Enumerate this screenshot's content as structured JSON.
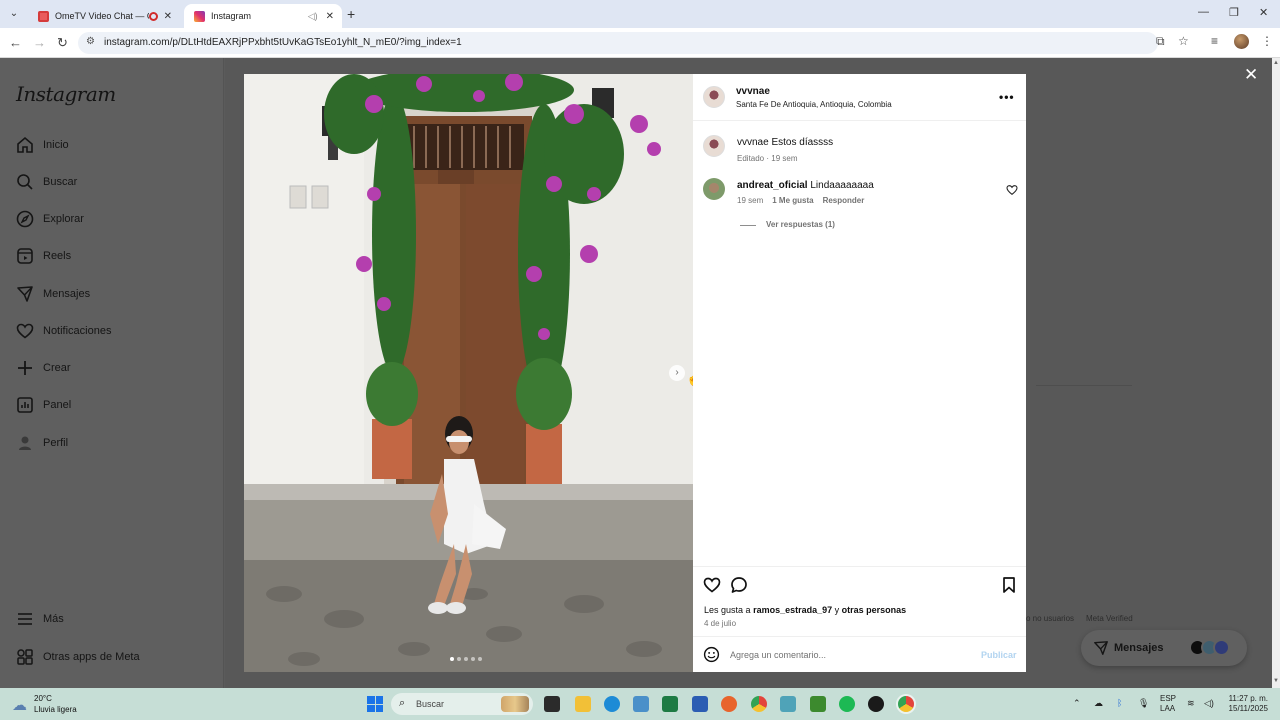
{
  "browser": {
    "tabs": [
      {
        "title": "OmeTV Video Chat — Ome",
        "active": false
      },
      {
        "title": "Instagram",
        "active": true
      }
    ],
    "url": "instagram.com/p/DLtHtdEAXRjPPxbht5tUvKaGTsEo1yhlt_N_mE0/?img_index=1"
  },
  "sidebar": {
    "logo": "Instagram",
    "items": [
      {
        "label": "Inicio",
        "icon": "home-icon"
      },
      {
        "label": "Buscar",
        "icon": "search-icon"
      },
      {
        "label": "Explorar",
        "icon": "compass-icon"
      },
      {
        "label": "Reels",
        "icon": "reels-icon"
      },
      {
        "label": "Mensajes",
        "icon": "messenger-icon"
      },
      {
        "label": "Notificaciones",
        "icon": "heart-icon"
      },
      {
        "label": "Crear",
        "icon": "plus-icon"
      },
      {
        "label": "Panel",
        "icon": "chart-icon"
      },
      {
        "label": "Perfil",
        "icon": "profile-icon"
      }
    ],
    "bottom_items": [
      {
        "label": "Más",
        "icon": "menu-icon"
      },
      {
        "label": "Otras apps de Meta",
        "icon": "meta-apps-icon"
      }
    ]
  },
  "post": {
    "username": "vvvnae",
    "location": "Santa Fe De Antioquia, Antioquia, Colombia",
    "caption_user": "vvvnae",
    "caption_text": "Estos díassss",
    "caption_meta": "Editado · 19 sem",
    "comment": {
      "user": "andreat_oficial",
      "text": "Lindaaaaaaaa",
      "time": "19 sem",
      "likes": "1 Me gusta",
      "reply": "Responder",
      "view_replies": "Ver respuestas (1)"
    },
    "likes_prefix": "Les gusta a",
    "likes_user": "ramos_estrada_97",
    "likes_join": "y",
    "likes_others": "otras personas",
    "date": "4 de julio",
    "comment_placeholder": "Agrega un comentario...",
    "publish_label": "Publicar",
    "carousel": {
      "count": 5,
      "current": 1
    }
  },
  "background": {
    "footer_left": "o no usuarios",
    "footer_right": "Meta Verified"
  },
  "messages_pill": {
    "label": "Mensajes"
  },
  "taskbar": {
    "weather_temp": "20°C",
    "weather_desc": "Lluvia ligera",
    "search_placeholder": "Buscar",
    "lang_top": "ESP",
    "lang_bottom": "LAA",
    "time": "11:27 p. m.",
    "date": "15/11/2025"
  },
  "colors": {
    "accent_blue": "#0095f6",
    "dim_overlay": "#5b5b5b",
    "taskbar": "#c6ded6"
  }
}
